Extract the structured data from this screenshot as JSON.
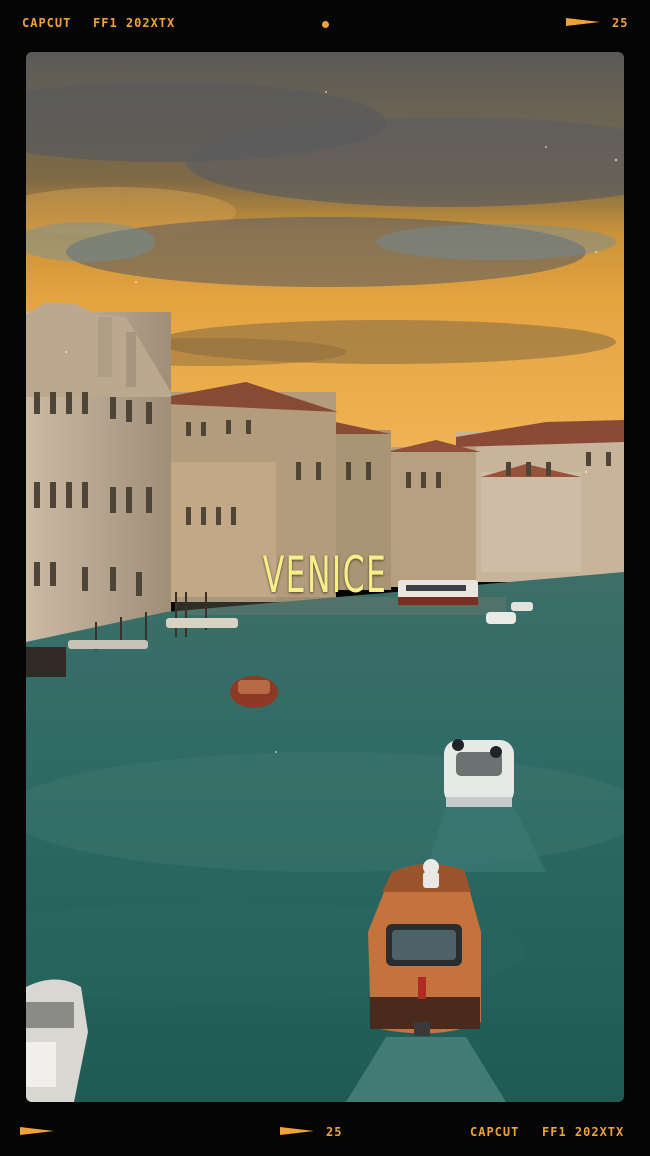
{
  "frame": {
    "top_brand": "CAPCUT",
    "top_code": "FF1 202XTX",
    "top_frame_number": "25",
    "bottom_frame_number": "25",
    "bottom_brand": "CAPCUT",
    "bottom_code": "FF1 202XTX",
    "accent_color": "#f0a23a"
  },
  "photo": {
    "caption": "VENICE",
    "caption_color": "#f7f089"
  }
}
